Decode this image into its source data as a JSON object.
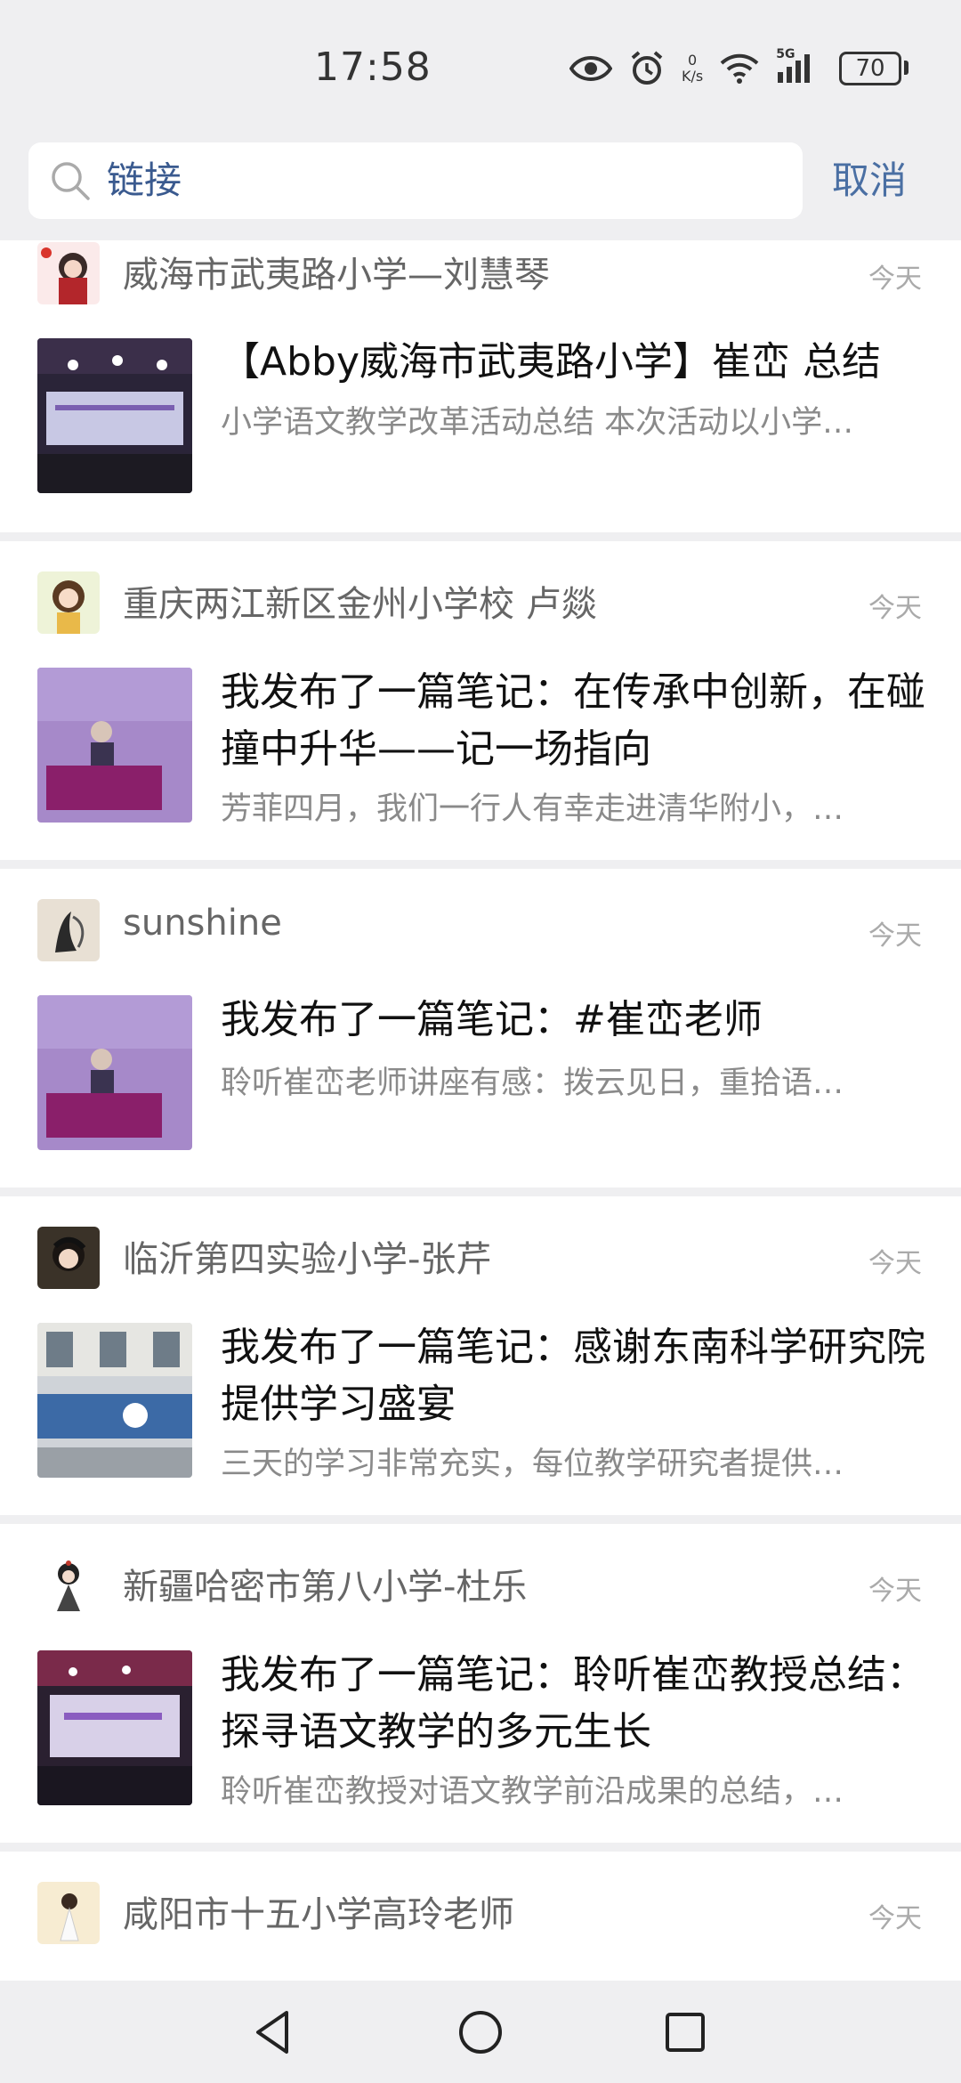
{
  "status": {
    "time": "17:58",
    "net_speed_value": "0",
    "net_speed_unit": "K/s",
    "signal_label": "5G",
    "battery": "70"
  },
  "search": {
    "query": "链接",
    "cancel_label": "取消"
  },
  "results": [
    {
      "author": "威海市武夷路小学—刘慧琴",
      "date": "今天",
      "title": "【Abby威海市武夷路小学】崔峦  总结",
      "summary": "小学语文教学改革活动总结 本次活动以小学…"
    },
    {
      "author": "重庆两江新区金州小学校  卢燚",
      "date": "今天",
      "title": "我发布了一篇笔记：在传承中创新，在碰撞中升华——记一场指向",
      "summary": "芳菲四月，我们一行人有幸走进清华附小，…"
    },
    {
      "author": "sunshine",
      "date": "今天",
      "title": "我发布了一篇笔记：#崔峦老师",
      "summary": "聆听崔峦老师讲座有感：拨云见日，重拾语…"
    },
    {
      "author": "临沂第四实验小学-张芹",
      "date": "今天",
      "title": "我发布了一篇笔记：感谢东南科学研究院提供学习盛宴",
      "summary": "三天的学习非常充实，每位教学研究者提供…"
    },
    {
      "author": "新疆哈密市第八小学-杜乐",
      "date": "今天",
      "title": "我发布了一篇笔记：聆听崔峦教授总结：探寻语文教学的多元生长",
      "summary": "聆听崔峦教授对语文教学前沿成果的总结，…"
    },
    {
      "author": "咸阳市十五小学高玲老师",
      "date": "今天"
    }
  ]
}
